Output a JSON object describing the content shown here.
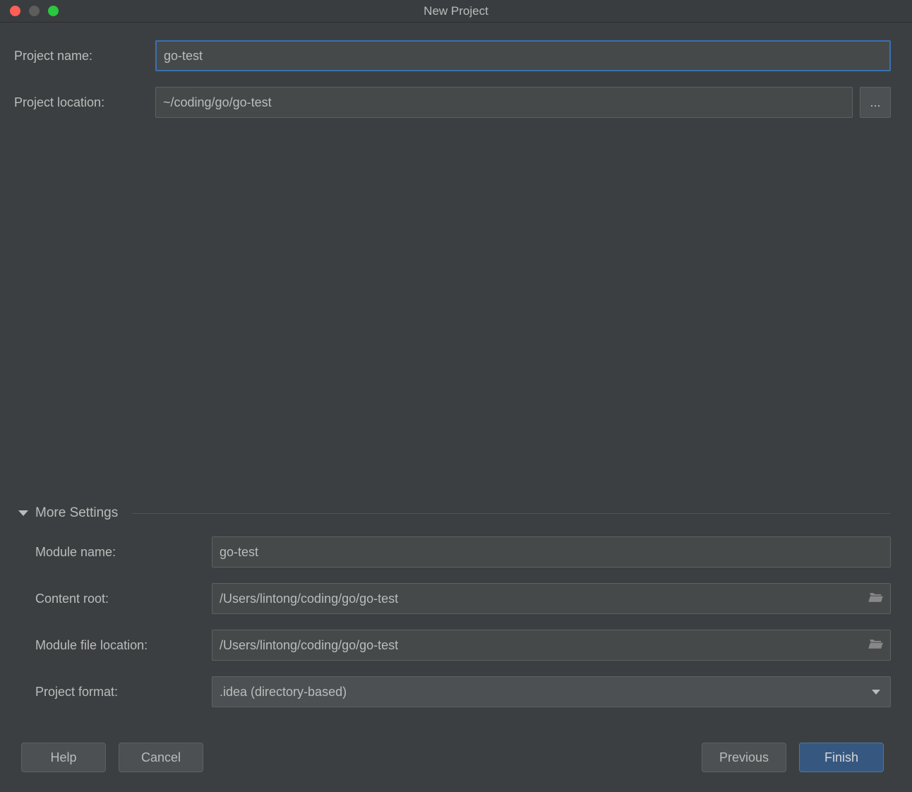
{
  "window": {
    "title": "New Project"
  },
  "labels": {
    "project_name": "Project name:",
    "project_location": "Project location:",
    "more_settings": "More Settings",
    "module_name": "Module name:",
    "content_root": "Content root:",
    "module_file_location": "Module file location:",
    "project_format": "Project format:"
  },
  "fields": {
    "project_name": "go-test",
    "project_location": "~/coding/go/go-test",
    "module_name": "go-test",
    "content_root": "/Users/lintong/coding/go/go-test",
    "module_file_location": "/Users/lintong/coding/go/go-test",
    "project_format": ".idea (directory-based)"
  },
  "buttons": {
    "browse": "...",
    "help": "Help",
    "cancel": "Cancel",
    "previous": "Previous",
    "finish": "Finish"
  }
}
